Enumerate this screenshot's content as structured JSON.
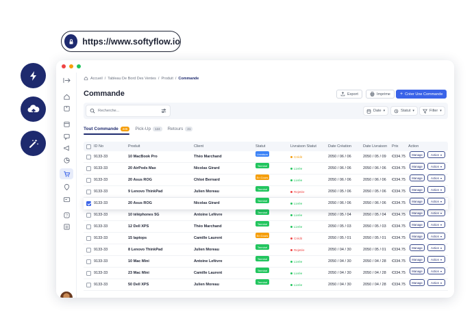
{
  "url": "https://www.softyflow.io",
  "colors": {
    "navy": "#1e2a6e",
    "primary": "#3a63e8",
    "green": "#22c55e",
    "blue": "#3b82f6",
    "orange": "#f59e0b",
    "red": "#ef4444"
  },
  "breadcrumb": {
    "items": [
      "Accueil",
      "Tableau De Bord Des Ventes",
      "Produit"
    ],
    "current": "Commande",
    "sep": "/"
  },
  "page_title": "Commande",
  "toolbar": {
    "export": "Export",
    "print": "Imprime",
    "create": "Créer Une Commande"
  },
  "search": {
    "placeholder": "Recherche..."
  },
  "filters": {
    "date": "Date",
    "status": "Statut",
    "filter": "Filter"
  },
  "tabs": [
    {
      "label": "Tout Commande",
      "count": "245"
    },
    {
      "label": "Pick-Up",
      "count": "124"
    },
    {
      "label": "Retours",
      "count": "21"
    }
  ],
  "table": {
    "headers": [
      "ID No",
      "Produit",
      "Client",
      "Statut",
      "Livraison Statut",
      "Date Création",
      "Date Livraison",
      "Prix",
      "Action"
    ],
    "manage_label": "Manage",
    "action_label": "Action",
    "rows": [
      {
        "id": "9133-33",
        "product": "10 MacBook Pro",
        "client": "Théo Marchand",
        "status": "Livraison",
        "status_color": "blue",
        "delivery": "Crédit",
        "delivery_color": "orange",
        "created": "2050 / 06 / 06",
        "delivered": "2050 / 05 / 09",
        "price": "€334.75",
        "checked": false
      },
      {
        "id": "9133-33",
        "product": "20 AirPods Max",
        "client": "Nicolas Girard",
        "status": "Terminé",
        "status_color": "green",
        "delivery": "Livrée",
        "delivery_color": "green",
        "created": "2050 / 06 / 06",
        "delivered": "2050 / 06 / 06",
        "price": "€334.75",
        "checked": false
      },
      {
        "id": "9133-33",
        "product": "20 Asus ROG",
        "client": "Chloé Bernard",
        "status": "En Cours",
        "status_color": "orange",
        "delivery": "Livrée",
        "delivery_color": "green",
        "created": "2050 / 06 / 06",
        "delivered": "2050 / 06 / 06",
        "price": "€334.75",
        "checked": false
      },
      {
        "id": "9133-33",
        "product": "9 Lenovo ThinkPad",
        "client": "Julien Moreau",
        "status": "Terminé",
        "status_color": "green",
        "delivery": "Rejetée",
        "delivery_color": "red",
        "created": "2050 / 05 / 06",
        "delivered": "2050 / 05 / 06",
        "price": "€334.75",
        "checked": false
      },
      {
        "id": "9133-33",
        "product": "20 Asus ROG",
        "client": "Nicolas Girard",
        "status": "Terminé",
        "status_color": "green",
        "delivery": "Livrée",
        "delivery_color": "green",
        "created": "2050 / 06 / 06",
        "delivered": "2050 / 06 / 06",
        "price": "€334.75",
        "checked": true
      },
      {
        "id": "9133-33",
        "product": "10 téléphones 5G",
        "client": "Antoine Lefèvre",
        "status": "Terminé",
        "status_color": "green",
        "delivery": "Livrée",
        "delivery_color": "green",
        "created": "2050 / 05 / 04",
        "delivered": "2050 / 05 / 04",
        "price": "€334.75",
        "checked": false
      },
      {
        "id": "9133-33",
        "product": "12 Dell XPS",
        "client": "Théo Marchand",
        "status": "Terminé",
        "status_color": "green",
        "delivery": "Livrée",
        "delivery_color": "green",
        "created": "2050 / 05 / 03",
        "delivered": "2050 / 05 / 03",
        "price": "€334.75",
        "checked": false
      },
      {
        "id": "9133-33",
        "product": "15 laptops",
        "client": "Camille Laurent",
        "status": "En Cours",
        "status_color": "orange",
        "delivery": "Crédit",
        "delivery_color": "red",
        "created": "2050 / 05 / 01",
        "delivered": "2050 / 05 / 01",
        "price": "€334.75",
        "checked": false
      },
      {
        "id": "9133-33",
        "product": "8 Lenovo ThinkPad",
        "client": "Julien Moreau",
        "status": "Terminé",
        "status_color": "green",
        "delivery": "Rejetée",
        "delivery_color": "red",
        "created": "2050 / 04 / 30",
        "delivered": "2050 / 05 / 01",
        "price": "€334.75",
        "checked": false
      },
      {
        "id": "9133-33",
        "product": "10 Mac Mini",
        "client": "Antoine Lefèvre",
        "status": "Terminé",
        "status_color": "green",
        "delivery": "Livrée",
        "delivery_color": "green",
        "created": "2050 / 04 / 30",
        "delivered": "2050 / 04 / 28",
        "price": "€334.75",
        "checked": false
      },
      {
        "id": "9133-33",
        "product": "23 Mac Mini",
        "client": "Camille Laurent",
        "status": "Terminé",
        "status_color": "green",
        "delivery": "Livrée",
        "delivery_color": "green",
        "created": "2050 / 04 / 30",
        "delivered": "2050 / 04 / 28",
        "price": "€334.75",
        "checked": false
      },
      {
        "id": "9133-33",
        "product": "50 Dell XPS",
        "client": "Julien Moreau",
        "status": "Terminé",
        "status_color": "green",
        "delivery": "Livrée",
        "delivery_color": "green",
        "created": "2050 / 04 / 30",
        "delivered": "2050 / 04 / 28",
        "price": "€334.75",
        "checked": false
      }
    ]
  }
}
